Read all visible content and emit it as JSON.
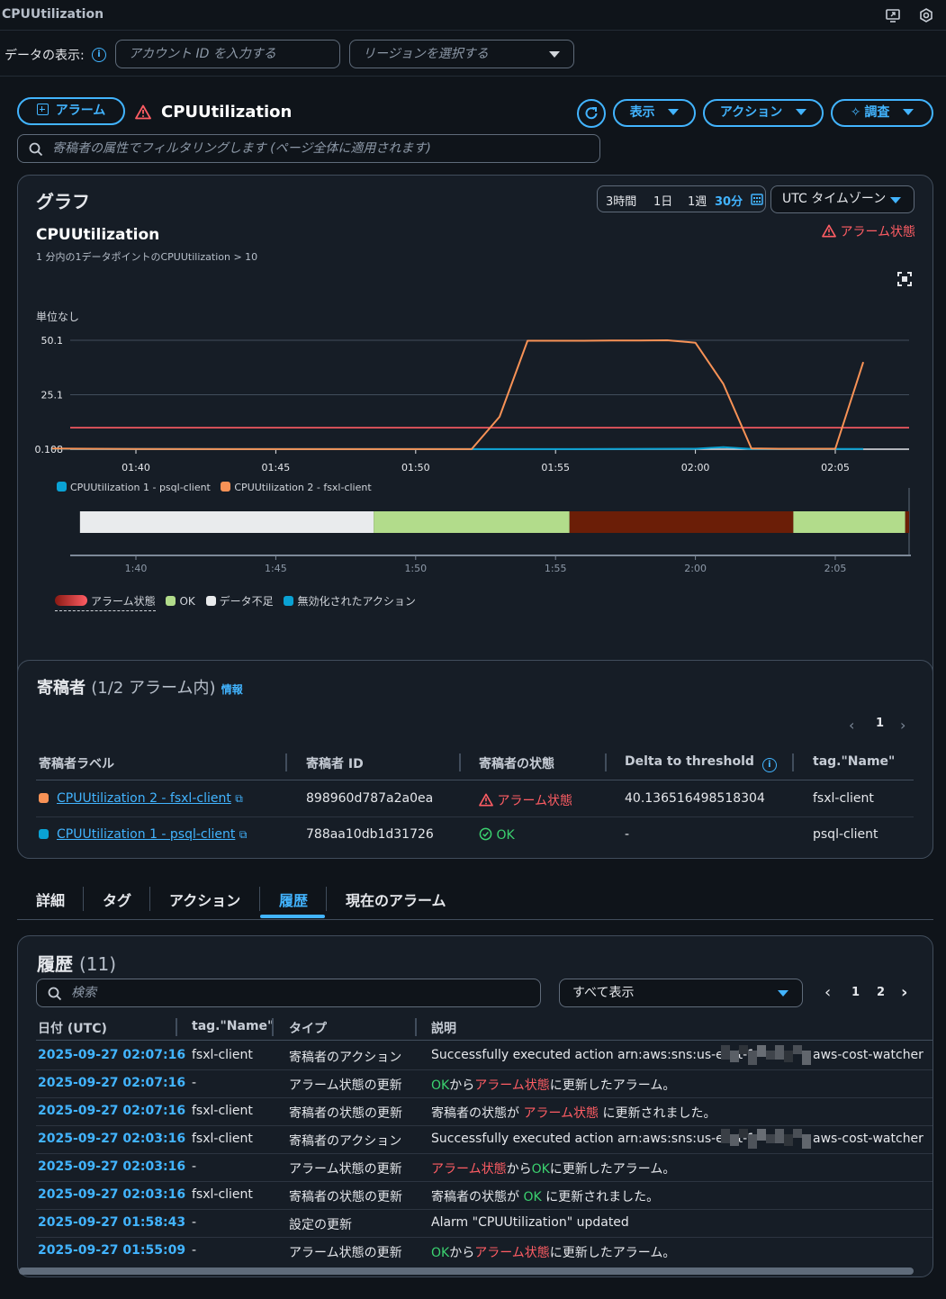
{
  "topbar": {
    "title": "CPUUtilization",
    "icons": [
      "monitor-icon",
      "settings-icon"
    ]
  },
  "data_view": {
    "label": "データの表示:",
    "account_placeholder": "アカウント ID を入力する",
    "region_placeholder": "リージョンを選択する"
  },
  "header": {
    "alarm_button": "アラーム",
    "title": "CPUUtilization",
    "view_button": "表示",
    "actions_button": "アクション",
    "investigate_button": "調査",
    "filter_placeholder": "寄稿者の属性でフィルタリングします (ページ全体に適用されます)"
  },
  "graph": {
    "heading": "グラフ",
    "ranges": [
      "3時間",
      "1日",
      "1週",
      "30分"
    ],
    "active_range": "30分",
    "timezone": "UTC タイムゾーン",
    "alarm_state": "アラーム状態",
    "chart_title": "CPUUtilization",
    "chart_subtitle": "1 分内の1データポイントのCPUUtilization > 10"
  },
  "chart_data": {
    "type": "line",
    "ylabel": "単位なし",
    "y_ticks": [
      "50.1",
      "25.1",
      "0.108"
    ],
    "ylim": [
      0.108,
      50.1
    ],
    "x_ticks": [
      "01:40",
      "01:45",
      "01:50",
      "01:55",
      "02:00",
      "02:05"
    ],
    "threshold": 10,
    "series": [
      {
        "name": "CPUUtilization 1 - psql-client",
        "color": "#0aa2d4",
        "x": [
          "01:37",
          "01:40",
          "01:45",
          "01:50",
          "01:52",
          "01:55",
          "02:00",
          "02:01",
          "02:02",
          "02:05",
          "02:06"
        ],
        "values": [
          0.3,
          0.2,
          0.15,
          0.15,
          0.15,
          0.15,
          0.3,
          1.0,
          0.2,
          0.2,
          0.2
        ]
      },
      {
        "name": "CPUUtilization 2 - fsxl-client",
        "color": "#f89256",
        "x": [
          "01:37",
          "01:40",
          "01:45",
          "01:50",
          "01:52",
          "01:53",
          "01:54",
          "01:55",
          "01:56",
          "01:57",
          "01:58",
          "01:59",
          "02:00",
          "02:01",
          "02:02",
          "02:03",
          "02:04",
          "02:05",
          "02:06"
        ],
        "values": [
          0.4,
          0.2,
          0.15,
          0.15,
          0.15,
          15,
          49.9,
          49.9,
          49.9,
          50.0,
          50.0,
          50.1,
          49.0,
          30,
          0.5,
          0.3,
          0.3,
          0.3,
          40.1
        ]
      }
    ],
    "state_timeline": {
      "x_ticks": [
        "1:40",
        "1:45",
        "1:50",
        "1:55",
        "2:00",
        "2:05"
      ],
      "segments": [
        {
          "state": "insufficient",
          "start": "01:38",
          "end": "01:48.5"
        },
        {
          "state": "ok",
          "start": "01:48.5",
          "end": "01:55.5"
        },
        {
          "state": "alarm",
          "start": "01:55.5",
          "end": "02:03.5"
        },
        {
          "state": "ok",
          "start": "02:03.5",
          "end": "02:07.5"
        },
        {
          "state": "alarm",
          "start": "02:07.5",
          "end": "02:08"
        }
      ],
      "colors": {
        "insufficient": "#e9ebed",
        "ok": "#b2dc8b",
        "alarm": "#6b1e07"
      }
    },
    "state_legend": [
      "アラーム状態",
      "OK",
      "データ不足",
      "無効化されたアクション"
    ]
  },
  "contributors": {
    "heading": "寄稿者",
    "count": "(1/2 アラーム内)",
    "info": "情報",
    "page": "1",
    "columns": [
      "寄稿者ラベル",
      "寄稿者 ID",
      "寄稿者の状態",
      "Delta to threshold",
      "tag.\"Name\""
    ],
    "rows": [
      {
        "label": "CPUUtilization 2 - fsxl-client",
        "id": "898960d787a2a0ea",
        "state": "アラーム状態",
        "delta": "40.136516498518304",
        "name": "fsxl-client",
        "color": "#f89256"
      },
      {
        "label": "CPUUtilization 1 - psql-client",
        "id": "788aa10db1d31726",
        "state": "OK",
        "delta": "-",
        "name": "psql-client",
        "color": "#0aa2d4"
      }
    ]
  },
  "tabs": [
    "詳細",
    "タグ",
    "アクション",
    "履歴",
    "現在のアラーム"
  ],
  "history": {
    "heading": "履歴",
    "count": "(11)",
    "search_placeholder": "検索",
    "filter_value": "すべて表示",
    "pages": [
      "1",
      "2"
    ],
    "columns": [
      "日付 (UTC)",
      "tag.\"Name\"",
      "タイプ",
      "説明"
    ],
    "rows": [
      {
        "date": "2025-09-27 02:07:16",
        "name": "fsxl-client",
        "type": "寄稿者のアクション",
        "desc": [
          "Successfully executed action arn:aws:sns:us-east-1",
          "aws-cost-watcher"
        ]
      },
      {
        "date": "2025-09-27 02:07:16",
        "name": "-",
        "type": "アラーム状態の更新",
        "desc": [
          "OK",
          "から",
          "アラーム状態",
          "に更新したアラーム。"
        ]
      },
      {
        "date": "2025-09-27 02:07:16",
        "name": "fsxl-client",
        "type": "寄稿者の状態の更新",
        "desc": [
          "寄稿者の状態が ",
          "アラーム状態",
          " に更新されました。"
        ]
      },
      {
        "date": "2025-09-27 02:03:16",
        "name": "fsxl-client",
        "type": "寄稿者のアクション",
        "desc": [
          "Successfully executed action arn:aws:sns:us-east-1",
          "aws-cost-watcher"
        ]
      },
      {
        "date": "2025-09-27 02:03:16",
        "name": "-",
        "type": "アラーム状態の更新",
        "desc": [
          "アラーム状態",
          "から",
          "OK",
          "に更新したアラーム。"
        ]
      },
      {
        "date": "2025-09-27 02:03:16",
        "name": "fsxl-client",
        "type": "寄稿者の状態の更新",
        "desc": [
          "寄稿者の状態が ",
          "OK",
          " に更新されました。"
        ]
      },
      {
        "date": "2025-09-27 01:58:43",
        "name": "-",
        "type": "設定の更新",
        "desc": [
          "Alarm \"CPUUtilization\" updated"
        ]
      },
      {
        "date": "2025-09-27 01:55:09",
        "name": "-",
        "type": "アラーム状態の更新",
        "desc": [
          "OK",
          "から",
          "アラーム状態",
          "に更新したアラーム。"
        ]
      }
    ]
  },
  "colors": {
    "accent": "#42b4ff",
    "alarm": "#ff5d64",
    "ok": "#3bd16f",
    "threshold": "#ff5d64"
  }
}
